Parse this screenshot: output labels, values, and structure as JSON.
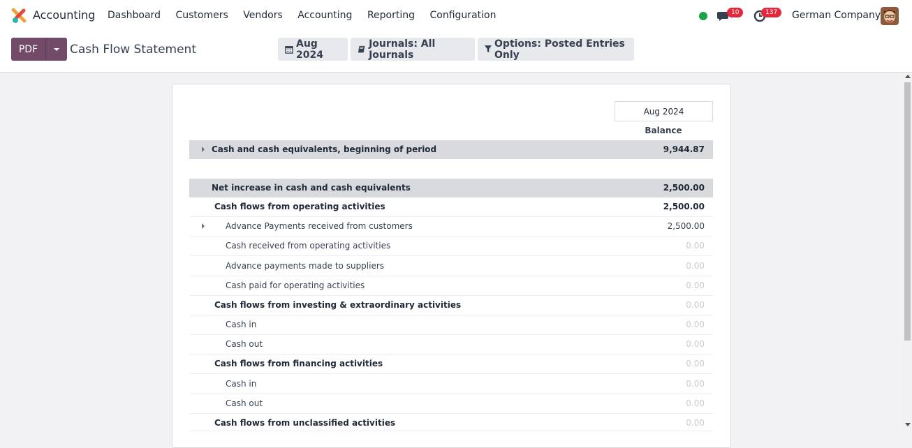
{
  "app": {
    "title": "Accounting"
  },
  "menu": [
    "Dashboard",
    "Customers",
    "Vendors",
    "Accounting",
    "Reporting",
    "Configuration"
  ],
  "systray": {
    "messages_count": "10",
    "activities_count": "137",
    "company": "German Company"
  },
  "control": {
    "pdf_label": "PDF",
    "page_title": "Cash Flow Statement",
    "filter_date": "Aug 2024",
    "filter_journals": "Journals: All Journals",
    "filter_options": "Options: Posted Entries Only"
  },
  "report": {
    "column_period": "Aug 2024",
    "column_label": "Balance",
    "rows": [
      {
        "label": "Cash and cash equivalents, beginning of period",
        "amount": "9,944.87"
      },
      {
        "label": "Net increase in cash and cash equivalents",
        "amount": "2,500.00"
      },
      {
        "label": "Cash flows from operating activities",
        "amount": "2,500.00"
      },
      {
        "label": "Advance Payments received from customers",
        "amount": "2,500.00"
      },
      {
        "label": "Cash received from operating activities",
        "amount": "0.00"
      },
      {
        "label": "Advance payments made to suppliers",
        "amount": "0.00"
      },
      {
        "label": "Cash paid for operating activities",
        "amount": "0.00"
      },
      {
        "label": "Cash flows from investing & extraordinary activities",
        "amount": "0.00"
      },
      {
        "label": "Cash in",
        "amount": "0.00"
      },
      {
        "label": "Cash out",
        "amount": "0.00"
      },
      {
        "label": "Cash flows from financing activities",
        "amount": "0.00"
      },
      {
        "label": "Cash in",
        "amount": "0.00"
      },
      {
        "label": "Cash out",
        "amount": "0.00"
      },
      {
        "label": "Cash flows from unclassified activities",
        "amount": "0.00"
      }
    ]
  },
  "colors": {
    "primary": "#714b67",
    "badge": "#e0293c",
    "online": "#1aa34a"
  }
}
